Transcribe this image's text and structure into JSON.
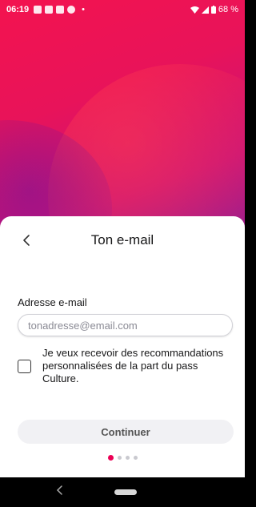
{
  "status_bar": {
    "time": "06:19",
    "separator": "•",
    "battery": "68 %"
  },
  "screen": {
    "title": "Ton e-mail",
    "back_icon": "chevron-left-icon"
  },
  "email": {
    "label": "Adresse e-mail",
    "placeholder": "tonadresse@email.com",
    "value": ""
  },
  "consent": {
    "checked": false,
    "text": "Je veux recevoir des recommandations personnalisées de la part du pass Culture."
  },
  "actions": {
    "continue_label": "Continuer"
  },
  "pager": {
    "total": 4,
    "current": 1
  },
  "colors": {
    "accent": "#eb0055",
    "gradient_top": "#f3134f",
    "gradient_bottom": "#8f1a96"
  }
}
